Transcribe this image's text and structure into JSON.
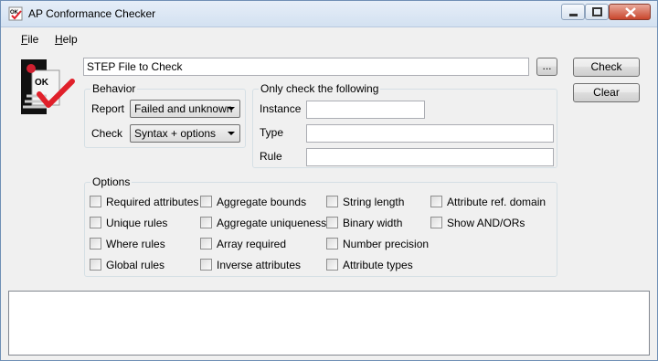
{
  "window": {
    "title": "AP Conformance Checker"
  },
  "menu": {
    "file": "File",
    "help": "Help"
  },
  "file_field": {
    "value": "STEP File to Check",
    "browse_label": "..."
  },
  "buttons": {
    "check": "Check",
    "clear": "Clear"
  },
  "behavior": {
    "title": "Behavior",
    "report_label": "Report",
    "report_value": "Failed and unknown",
    "check_label": "Check",
    "check_value": "Syntax + options"
  },
  "only_check": {
    "title": "Only check the following",
    "instance_label": "Instance",
    "instance_value": "",
    "type_label": "Type",
    "type_value": "",
    "rule_label": "Rule",
    "rule_value": ""
  },
  "options": {
    "title": "Options",
    "items": [
      {
        "label": "Required attributes",
        "checked": false
      },
      {
        "label": "Unique rules",
        "checked": false
      },
      {
        "label": "Where rules",
        "checked": false
      },
      {
        "label": "Global rules",
        "checked": false
      },
      {
        "label": "Aggregate bounds",
        "checked": false
      },
      {
        "label": "Aggregate uniqueness",
        "checked": false
      },
      {
        "label": "Array required",
        "checked": false
      },
      {
        "label": "Inverse attributes",
        "checked": false
      },
      {
        "label": "String length",
        "checked": false
      },
      {
        "label": "Binary width",
        "checked": false
      },
      {
        "label": "Number precision",
        "checked": false
      },
      {
        "label": "Attribute types",
        "checked": false
      },
      {
        "label": "Attribute ref. domain",
        "checked": false
      },
      {
        "label": "Show AND/ORs",
        "checked": false
      }
    ]
  },
  "colors": {
    "window_bg": "#f0f0f0",
    "check_mark": "#e0202a",
    "close_button": "#c9462c"
  },
  "icons": [
    "app-ok-icon",
    "minimize-icon",
    "maximize-icon",
    "close-icon",
    "dropdown-arrow-icon"
  ]
}
